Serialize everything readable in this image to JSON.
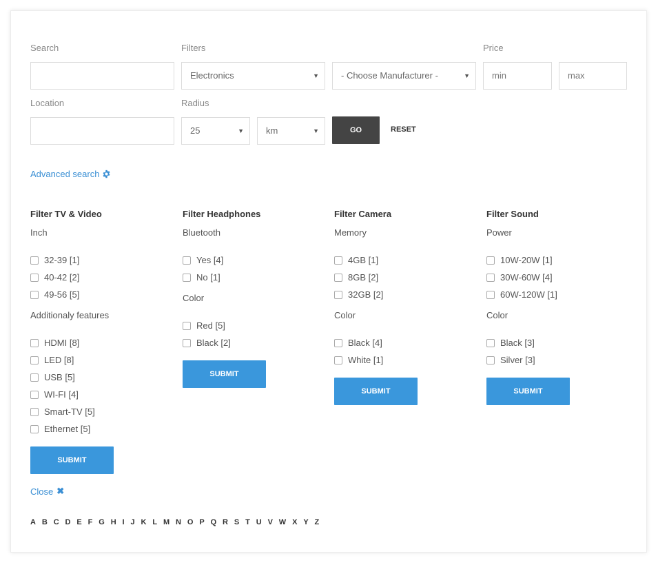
{
  "search": {
    "label": "Search",
    "value": ""
  },
  "filters": {
    "label": "Filters",
    "category": {
      "selected": "Electronics"
    },
    "manufacturer": {
      "selected": "- Choose Manufacturer -"
    }
  },
  "price": {
    "label": "Price",
    "min_placeholder": "min",
    "max_placeholder": "max"
  },
  "location": {
    "label": "Location",
    "value": ""
  },
  "radius": {
    "label": "Radius",
    "value": {
      "selected": "25"
    },
    "unit": {
      "selected": "km"
    }
  },
  "actions": {
    "go_label": "GO",
    "reset_label": "RESET"
  },
  "advanced_search_label": "Advanced search",
  "filter_columns": [
    {
      "title": "Filter TV & Video",
      "groups": [
        {
          "label": "Inch",
          "options": [
            "32-39 [1]",
            "40-42 [2]",
            "49-56 [5]"
          ]
        },
        {
          "label": "Additionaly features",
          "options": [
            "HDMI [8]",
            "LED [8]",
            "USB [5]",
            "WI-FI [4]",
            "Smart-TV [5]",
            "Ethernet [5]"
          ]
        }
      ],
      "submit_label": "SUBMIT"
    },
    {
      "title": "Filter Headphones",
      "groups": [
        {
          "label": "Bluetooth",
          "options": [
            "Yes [4]",
            "No [1]"
          ]
        },
        {
          "label": "Color",
          "options": [
            "Red [5]",
            "Black [2]"
          ]
        }
      ],
      "submit_label": "SUBMIT"
    },
    {
      "title": "Filter Camera",
      "groups": [
        {
          "label": "Memory",
          "options": [
            "4GB [1]",
            "8GB [2]",
            "32GB [2]"
          ]
        },
        {
          "label": "Color",
          "options": [
            "Black [4]",
            "White [1]"
          ]
        }
      ],
      "submit_label": "SUBMIT"
    },
    {
      "title": "Filter Sound",
      "groups": [
        {
          "label": "Power",
          "options": [
            "10W-20W [1]",
            "30W-60W [4]",
            "60W-120W [1]"
          ]
        },
        {
          "label": "Color",
          "options": [
            "Black [3]",
            "Silver [3]"
          ]
        }
      ],
      "submit_label": "SUBMIT"
    }
  ],
  "close_label": "Close",
  "alphabet": [
    "A",
    "B",
    "C",
    "D",
    "E",
    "F",
    "G",
    "H",
    "I",
    "J",
    "K",
    "L",
    "M",
    "N",
    "O",
    "P",
    "Q",
    "R",
    "S",
    "T",
    "U",
    "V",
    "W",
    "X",
    "Y",
    "Z"
  ],
  "colors": {
    "accent": "#3a97dc",
    "link": "#3a8fd4",
    "dark_button": "#444444"
  }
}
